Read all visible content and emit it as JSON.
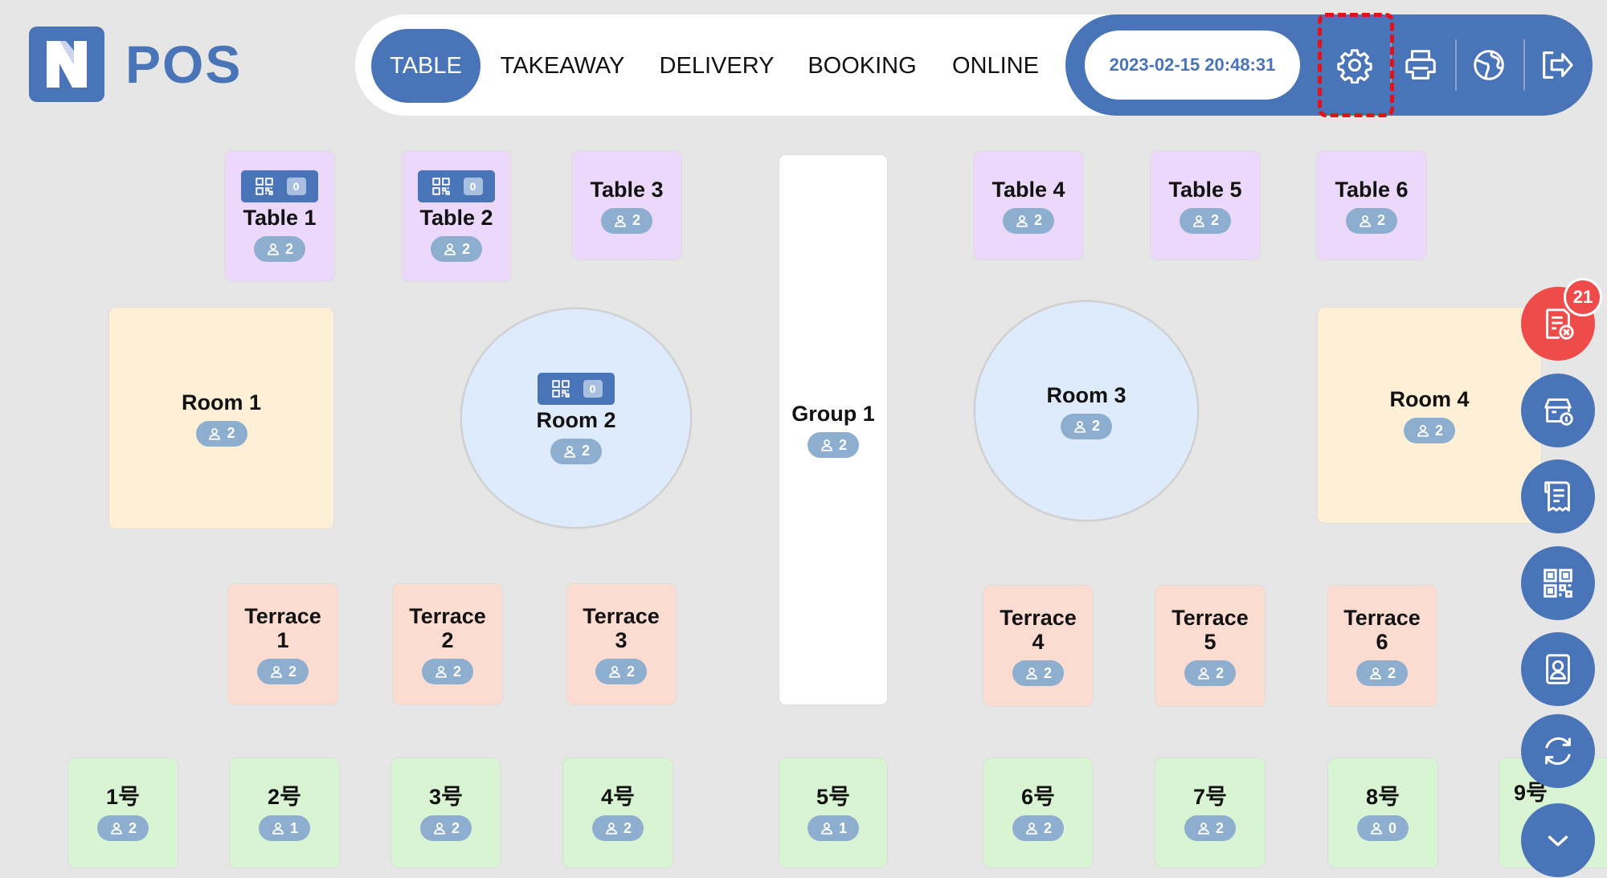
{
  "app": {
    "logo_text": "POS"
  },
  "nav": {
    "tabs": [
      {
        "label": "TABLE",
        "active": true
      },
      {
        "label": "TAKEAWAY",
        "active": false
      },
      {
        "label": "DELIVERY",
        "active": false
      },
      {
        "label": "BOOKING",
        "active": false
      },
      {
        "label": "ONLINE",
        "active": false
      }
    ]
  },
  "header": {
    "datetime": "2023-02-15 20:48:31",
    "icons": [
      "gear-icon",
      "printer-icon",
      "globe-icon",
      "logout-icon"
    ]
  },
  "tables": [
    {
      "name": "Table 1",
      "guests": "2",
      "qr": "0",
      "color": "#ecd8fb"
    },
    {
      "name": "Table 2",
      "guests": "2",
      "qr": "0",
      "color": "#ecd8fb"
    },
    {
      "name": "Table 3",
      "guests": "2",
      "color": "#ecd8fb"
    },
    {
      "name": "Table 4",
      "guests": "2",
      "color": "#ecd8fb"
    },
    {
      "name": "Table 5",
      "guests": "2",
      "color": "#ecd8fb"
    },
    {
      "name": "Table 6",
      "guests": "2",
      "color": "#ecd8fb"
    },
    {
      "name": "Room 1",
      "guests": "2",
      "color": "#fdf0d6"
    },
    {
      "name": "Room 2",
      "guests": "2",
      "qr": "0",
      "color": "#ddebfc"
    },
    {
      "name": "Group 1",
      "guests": "2",
      "color": "#ffffff"
    },
    {
      "name": "Room 3",
      "guests": "2",
      "color": "#ddebfc"
    },
    {
      "name": "Room 4",
      "guests": "2",
      "color": "#fdf0d6"
    },
    {
      "name": "Terrace\n1",
      "guests": "2",
      "color": "#fcdcd1"
    },
    {
      "name": "Terrace\n2",
      "guests": "2",
      "color": "#fcdcd1"
    },
    {
      "name": "Terrace\n3",
      "guests": "2",
      "color": "#fcdcd1"
    },
    {
      "name": "Terrace\n4",
      "guests": "2",
      "color": "#fcdcd1"
    },
    {
      "name": "Terrace\n5",
      "guests": "2",
      "color": "#fcdcd1"
    },
    {
      "name": "Terrace\n6",
      "guests": "2",
      "color": "#fcdcd1"
    },
    {
      "name": "1号",
      "guests": "2",
      "color": "#d9f4d3"
    },
    {
      "name": "2号",
      "guests": "1",
      "color": "#d9f4d3"
    },
    {
      "name": "3号",
      "guests": "2",
      "color": "#d9f4d3"
    },
    {
      "name": "4号",
      "guests": "2",
      "color": "#d9f4d3"
    },
    {
      "name": "5号",
      "guests": "1",
      "color": "#d9f4d3"
    },
    {
      "name": "6号",
      "guests": "2",
      "color": "#d9f4d3"
    },
    {
      "name": "7号",
      "guests": "2",
      "color": "#d9f4d3"
    },
    {
      "name": "8号",
      "guests": "0",
      "color": "#d9f4d3"
    },
    {
      "name": "9号",
      "guests": "",
      "color": "#d9f4d3"
    }
  ],
  "side": {
    "notification_count": "21",
    "buttons": [
      "cancel-order-icon",
      "cashier-icon",
      "receipt-icon",
      "qr-code-icon",
      "member-card-icon",
      "refresh-icon",
      "chevron-down-icon"
    ]
  },
  "colors": {
    "primary": "#4a74b8",
    "alert": "#f04b4b",
    "highlight": "#e3111a"
  }
}
